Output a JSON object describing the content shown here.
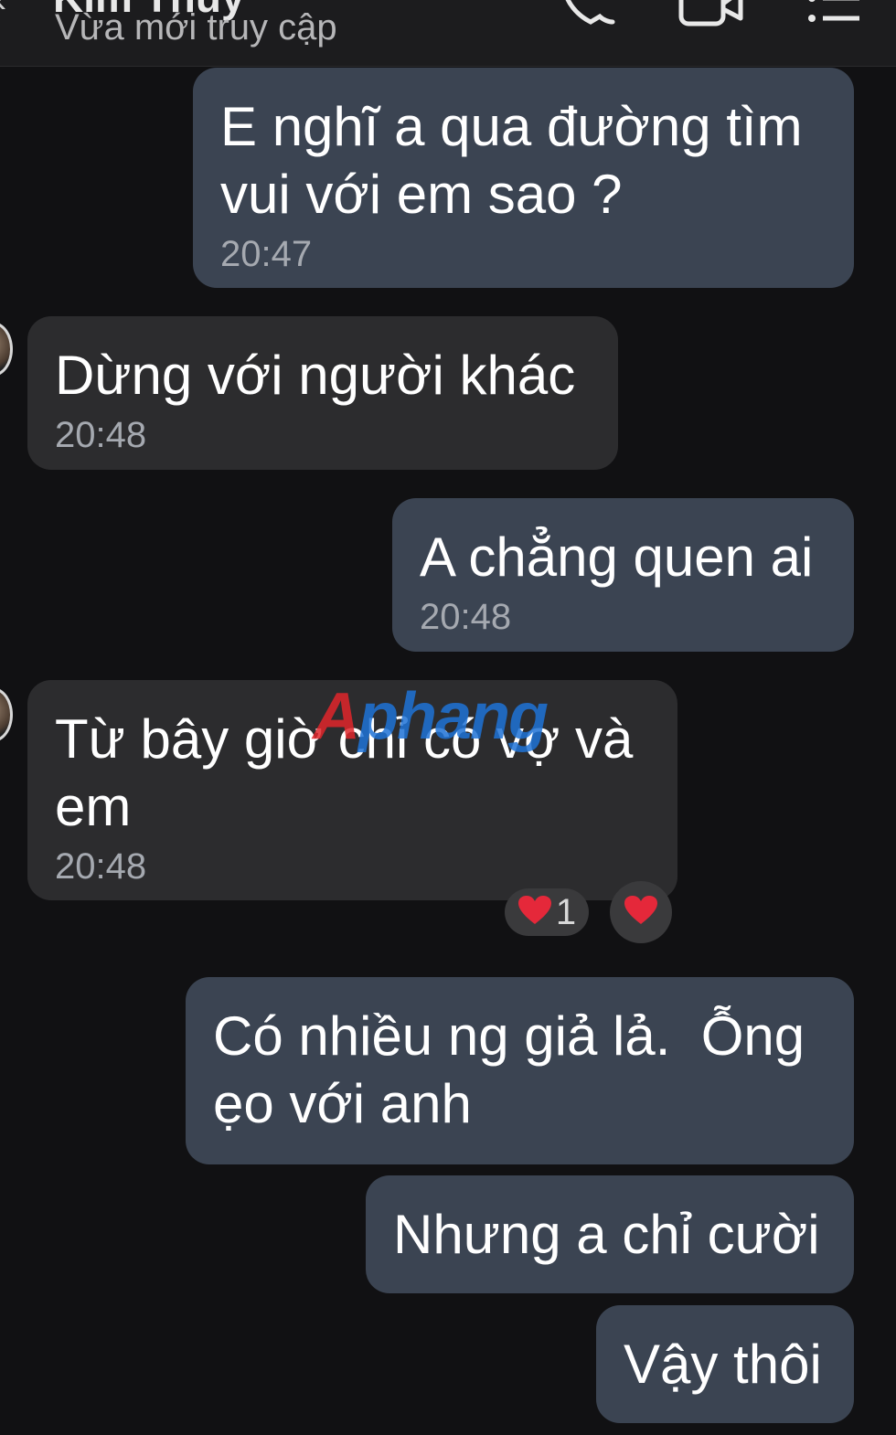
{
  "header": {
    "contact_name": "Kim Thủy",
    "status": "Vừa mới truy cập",
    "back_icon": "back-arrow-icon",
    "call_icon": "phone-icon",
    "video_icon": "video-camera-icon",
    "menu_icon": "list-menu-icon"
  },
  "messages": [
    {
      "direction": "out",
      "text": "E nghĩ a qua đường tìm\nvui với em sao ?",
      "time": "20:47"
    },
    {
      "direction": "in",
      "text": "Dừng với người khác",
      "time": "20:48"
    },
    {
      "direction": "out",
      "text": "A chẳng quen ai",
      "time": "20:48"
    },
    {
      "direction": "in",
      "text": "Từ bây giờ chỉ có vợ và\nem",
      "time": "20:48",
      "reactions": [
        {
          "emoji": "heart",
          "count": "1"
        }
      ]
    },
    {
      "direction": "out",
      "text": "Có nhiều ng giả lả.  Ỗng\nẹo với anh"
    },
    {
      "direction": "out",
      "text": "Nhưng a chỉ cười"
    },
    {
      "direction": "out",
      "text": "Vậy thôi"
    }
  ],
  "watermark": {
    "first": "A",
    "rest": "phang"
  },
  "colors": {
    "background": "#111113",
    "outgoing_bubble": "#3b4452",
    "incoming_bubble": "#2c2c2e",
    "timestamp": "#a5a9b0",
    "heart": "#e5283a"
  }
}
